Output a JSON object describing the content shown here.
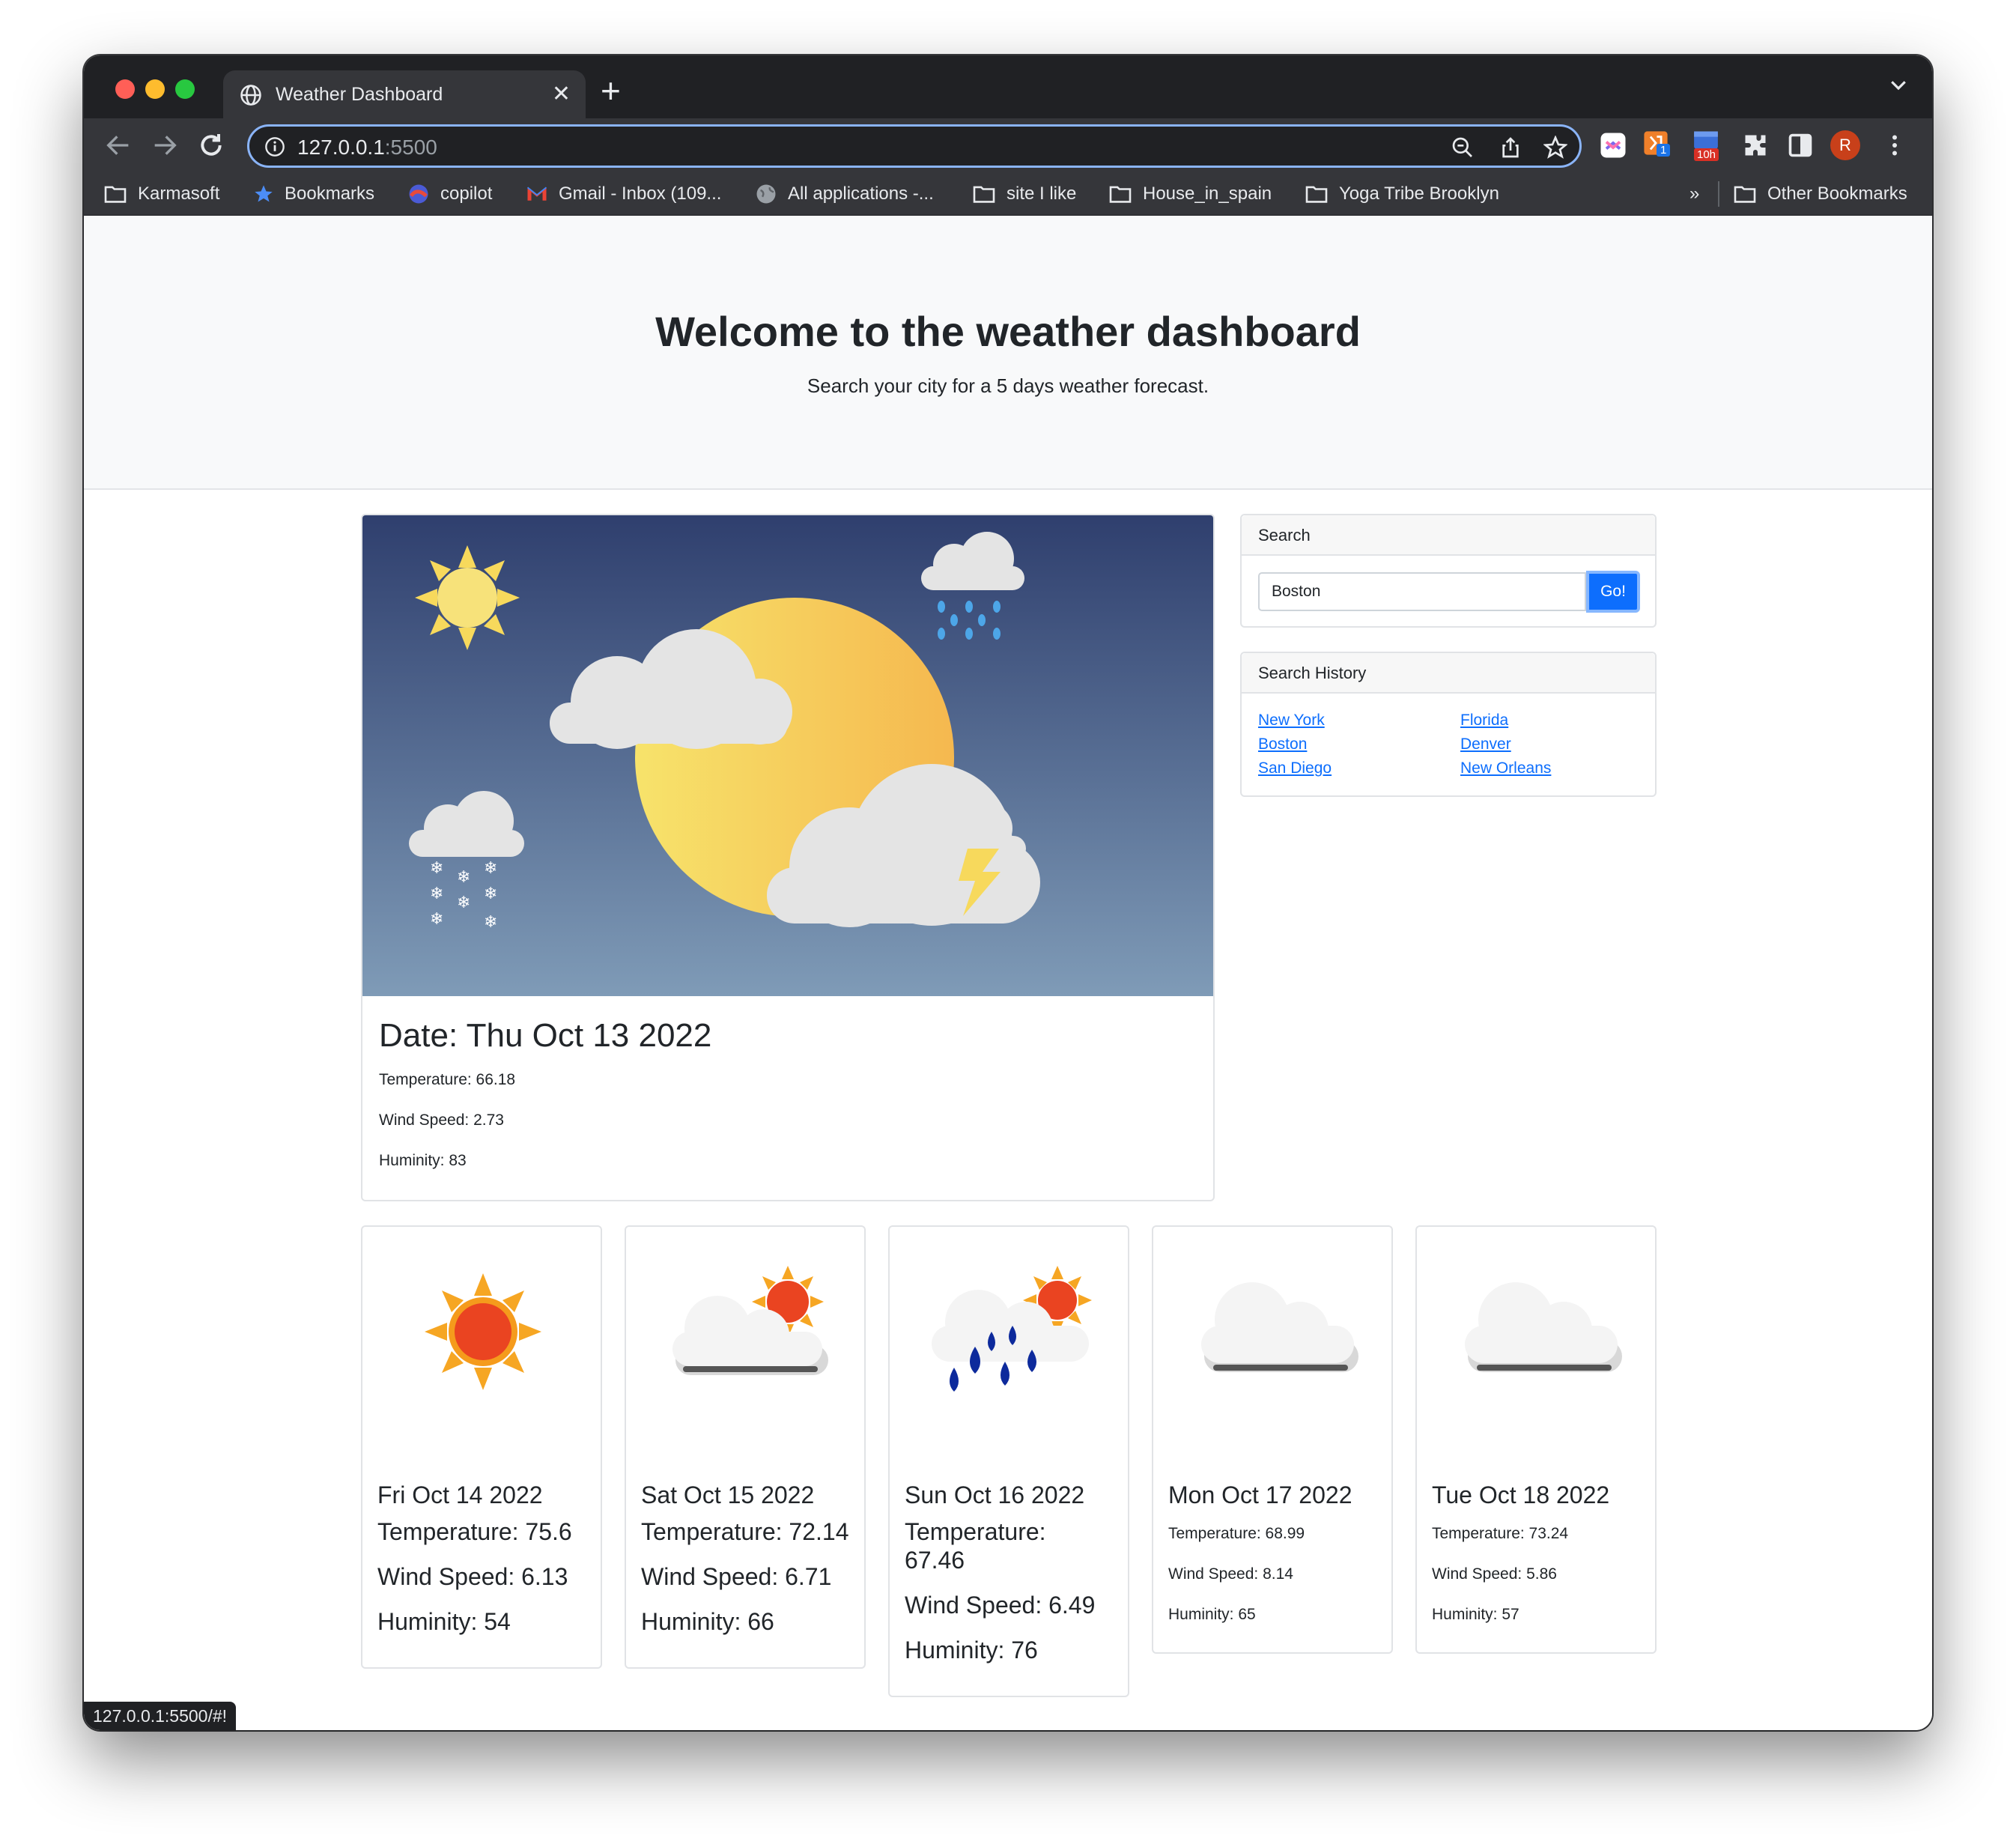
{
  "browser": {
    "tab_title": "Weather Dashboard",
    "url_host": "127.0.0.1",
    "url_port": ":5500",
    "bookmarks": [
      {
        "label": "Karmasoft",
        "icon": "folder-icon"
      },
      {
        "label": "Bookmarks",
        "icon": "star-icon"
      },
      {
        "label": "copilot",
        "icon": "copilot-icon"
      },
      {
        "label": "Gmail - Inbox (109...",
        "icon": "gmail-icon"
      },
      {
        "label": "All applications -...",
        "icon": "globe-icon"
      },
      {
        "label": "site I like",
        "icon": "folder-icon"
      },
      {
        "label": "House_in_spain",
        "icon": "folder-icon"
      },
      {
        "label": "Yoga Tribe Brooklyn",
        "icon": "folder-icon"
      },
      {
        "label": "Other Bookmarks",
        "icon": "folder-icon"
      }
    ],
    "overflow_label": "»",
    "extension_badges": {
      "ext1": "1",
      "ext2": "10h"
    },
    "profile_initial": "R",
    "status_url": "127.0.0.1:5500/#!"
  },
  "hero": {
    "title": "Welcome to the weather dashboard",
    "subtitle": "Search your city for a 5 days weather forecast."
  },
  "current": {
    "date": "Date: Thu Oct 13 2022",
    "temperature": "Temperature: 66.18",
    "wind": "Wind Speed: 2.73",
    "humidity": "Huminity: 83"
  },
  "search": {
    "header": "Search",
    "value": "Boston",
    "button": "Go!"
  },
  "history": {
    "header": "Search History",
    "cities": [
      "New York",
      "Florida",
      "Boston",
      "Denver",
      "San Diego",
      "New Orleans"
    ]
  },
  "forecast": [
    {
      "date": "Fri Oct 14 2022",
      "temperature": "Temperature: 75.6",
      "wind": "Wind Speed: 6.13",
      "humidity": "Huminity: 54",
      "icon": "sun-icon"
    },
    {
      "date": "Sat Oct 15 2022",
      "temperature": "Temperature: 72.14",
      "wind": "Wind Speed: 6.71",
      "humidity": "Huminity: 66",
      "icon": "partly-cloudy-icon"
    },
    {
      "date": "Sun Oct 16 2022",
      "temperature_line1": "Temperature:",
      "temperature_line2": "67.46",
      "wind": "Wind Speed: 6.49",
      "humidity": "Huminity: 76",
      "icon": "rain-sun-icon"
    },
    {
      "date": "Mon Oct 17 2022",
      "temperature": "Temperature: 68.99",
      "wind": "Wind Speed: 8.14",
      "humidity": "Huminity: 65",
      "icon": "cloud-icon"
    },
    {
      "date": "Tue Oct 18 2022",
      "temperature": "Temperature: 73.24",
      "wind": "Wind Speed: 5.86",
      "humidity": "Huminity: 57",
      "icon": "cloud-icon"
    }
  ],
  "colors": {
    "accent": "#0d6efd",
    "link": "#0d6efd",
    "sky_top": "#2f3f6e",
    "sky_bottom": "#7f9bb7",
    "sun": "#f7d95c"
  }
}
